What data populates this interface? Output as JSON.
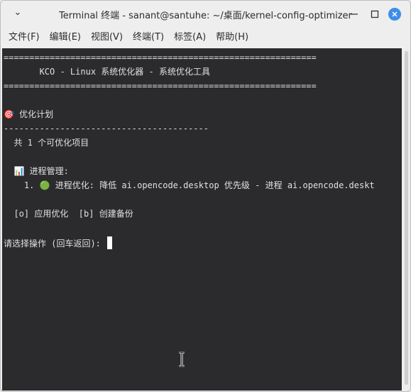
{
  "window": {
    "title": "Terminal 终端 - sanant@santuhe: ~/桌面/kernel-config-optimizer",
    "controls": {
      "minimize": "─",
      "maximize": "□",
      "close": "✕"
    }
  },
  "menu": [
    "文件(F)",
    "编辑(E)",
    "视图(V)",
    "终端(T)",
    "标签(A)",
    "帮助(H)"
  ],
  "terminal": {
    "separator_top": "=============================================================",
    "banner": "       KCO - Linux 系统优化器 - 系统优化工具",
    "separator_bottom": "=============================================================",
    "plan_icon": "🎯",
    "plan_title": " 优化计划",
    "plan_rule": "----------------------------------------",
    "count_line": "  共 1 个可优化项目",
    "category_icon": "📊",
    "category_title": " 进程管理:",
    "item_prefix": "    1. ",
    "item_icon": "🟢",
    "item_text": " 进程优化: 降低 ai.opencode.desktop 优先级 - 进程 ai.opencode.deskt",
    "actions_line": "  [o] 应用优化  [b] 创建备份",
    "prompt": "请选择操作 (回车返回): "
  }
}
